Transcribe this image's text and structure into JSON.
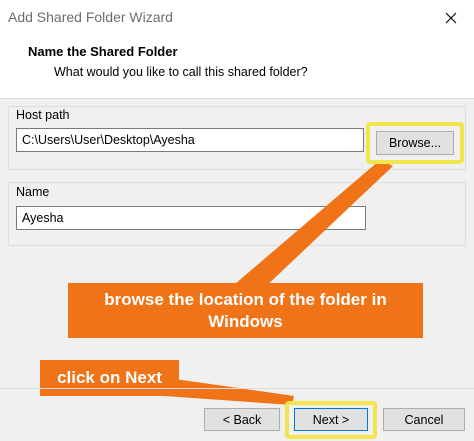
{
  "window": {
    "title": "Add Shared Folder Wizard",
    "close_glyph": "✕"
  },
  "header": {
    "title": "Name the Shared Folder",
    "subtitle": "What would you like to call this shared folder?"
  },
  "host_path": {
    "label": "Host path",
    "value": "C:\\Users\\User\\Desktop\\Ayesha",
    "browse_label": "Browse..."
  },
  "name": {
    "label": "Name",
    "value": "Ayesha"
  },
  "annotations": {
    "browse_callout": "browse the location of the folder in Windows",
    "next_callout": "click on Next",
    "color": "#f07417",
    "highlight_color": "#f2e64d"
  },
  "footer": {
    "back_label": "< Back",
    "next_label": "Next >",
    "cancel_label": "Cancel"
  }
}
